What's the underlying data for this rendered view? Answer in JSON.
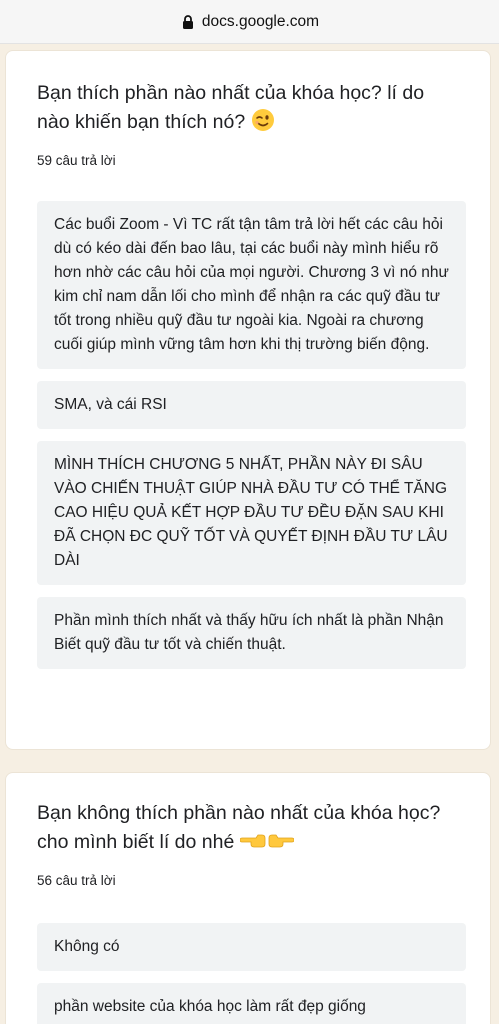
{
  "browser": {
    "url": "docs.google.com"
  },
  "questions": [
    {
      "title": "Bạn thích phần nào nhất của khóa học? lí do nào khiến bạn thích nó?",
      "emoji": "winking-face",
      "count": "59 câu trả lời",
      "answers": [
        "Các buổi Zoom - Vì TC rất tận tâm trả lời hết các câu hỏi dù có kéo dài đến bao lâu, tại các buổi này mình hiểu rõ hơn nhờ các câu hỏi của mọi người. Chương 3 vì nó như kim chỉ nam dẫn lối cho mình để nhận ra các quỹ đầu tư tốt trong nhiều quỹ đầu tư ngoài kia. Ngoài ra chương cuối giúp mình vững tâm hơn khi thị trường biến động.",
        "SMA, và cái RSI",
        "MÌNH THÍCH CHƯƠNG 5 NHẤT, PHẦN NÀY ĐI SÂU VÀO CHIẾN THUẬT GIÚP NHÀ ĐẦU TƯ CÓ THỂ TĂNG CAO HIỆU QUẢ KẾT HỢP ĐẦU TƯ ĐỀU ĐẶN SAU KHI ĐÃ CHỌN ĐC QUỸ TỐT VÀ QUYẾT ĐỊNH ĐẦU TƯ LÂU DÀI",
        "Phần mình thích nhất và thấy hữu ích nhất là phần Nhận Biết quỹ đầu tư tốt và chiến thuật."
      ]
    },
    {
      "title": "Bạn không thích phần nào nhất của khóa học? cho mình biết lí do nhé",
      "emoji": "pointing-hands",
      "count": "56 câu trả lời",
      "answers": [
        "Không có",
        "phần website của khóa học làm rất đẹp giống"
      ]
    }
  ]
}
